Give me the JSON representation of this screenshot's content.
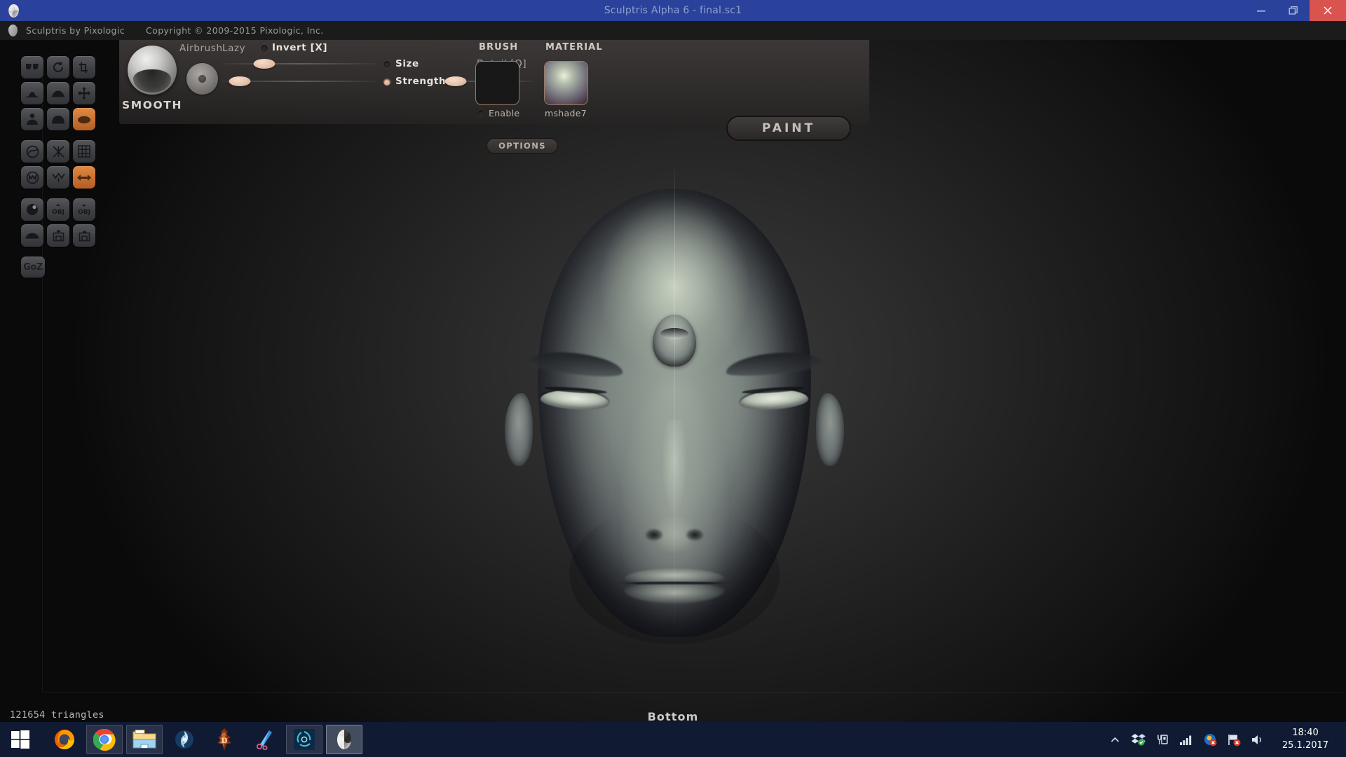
{
  "window": {
    "title": "Sculptris Alpha 6 - final.sc1",
    "app_icon": "sculptris-logo-icon",
    "minimize_label": "Minimize",
    "restore_label": "Restore",
    "close_label": "Close",
    "titlebar_color": "#2a429b",
    "close_color": "#d9534f"
  },
  "menustrip": {
    "app_name": "Sculptris by Pixologic",
    "copyright": "Copyright © 2009-2015 Pixologic, Inc."
  },
  "toolpalette": {
    "rows": [
      [
        {
          "name": "tool-crease",
          "icon": "crease-icon",
          "active": false
        },
        {
          "name": "tool-rotate",
          "icon": "rotate-icon",
          "active": false
        },
        {
          "name": "tool-crop",
          "icon": "crop-icon",
          "active": false
        }
      ],
      [
        {
          "name": "tool-draw",
          "icon": "draw-icon",
          "active": false
        },
        {
          "name": "tool-inflate",
          "icon": "inflate-icon",
          "active": false
        },
        {
          "name": "tool-grab",
          "icon": "move-arrows-icon",
          "active": false
        }
      ],
      [
        {
          "name": "tool-pinch",
          "icon": "pinch-icon",
          "active": false
        },
        {
          "name": "tool-flatten",
          "icon": "flatten-icon",
          "active": false
        },
        {
          "name": "tool-smooth",
          "icon": "smooth-icon",
          "active": true
        }
      ]
    ],
    "rows2": [
      [
        {
          "name": "tool-reduce-brush",
          "icon": "circle-swirl-icon",
          "active": false
        },
        {
          "name": "tool-mask",
          "icon": "x-cross-icon",
          "active": false
        },
        {
          "name": "tool-wireframe",
          "icon": "grid-icon",
          "active": false
        }
      ],
      [
        {
          "name": "tool-mask-toggle",
          "icon": "m-circle-icon",
          "active": false
        },
        {
          "name": "tool-reduce-selected",
          "icon": "w-arrow-icon",
          "active": false
        },
        {
          "name": "tool-symmetry",
          "icon": "double-arrow-icon",
          "active": true
        }
      ]
    ],
    "rows3": [
      [
        {
          "name": "tool-new-sphere",
          "icon": "sphere-icon",
          "active": false
        },
        {
          "name": "tool-import-obj",
          "icon": "obj-import-icon",
          "active": false
        },
        {
          "name": "tool-export-obj",
          "icon": "obj-export-icon",
          "active": false
        }
      ],
      [
        {
          "name": "tool-new-plane",
          "icon": "plane-icon",
          "active": false
        },
        {
          "name": "tool-open-file",
          "icon": "open-icon",
          "active": false
        },
        {
          "name": "tool-save-file",
          "icon": "save-icon",
          "active": false
        }
      ]
    ],
    "goz_label": "GoZ"
  },
  "brushbar": {
    "brush_name": "SMOOTH",
    "brush_preview_icon": "smooth-brush-preview-icon",
    "falloff_icon": "falloff-knob-icon",
    "airbrush_label": "Airbrush",
    "lazy_label": "Lazy",
    "invert_label": "Invert [X]",
    "size_label": "Size",
    "strength_label": "Strength",
    "detail_label": "Detail [Q]",
    "options_label": "OPTIONS",
    "size_value": 28,
    "strength_value": 12,
    "detail_value": 14,
    "invert_on": false,
    "size_on": false,
    "strength_on": true
  },
  "brushpanel": {
    "brush_title": "BRUSH",
    "brush_enable_label": "Enable",
    "brush_enabled": false,
    "material_title": "MATERIAL",
    "material_name": "mshade7",
    "paint_label": "PAINT",
    "swatch_border_color": "#9a7a64"
  },
  "viewport": {
    "triangle_count": "121654 triangles",
    "view_label": "Bottom",
    "model": "head-sculpt"
  },
  "taskbar": {
    "start_label": "Start",
    "apps": [
      {
        "name": "taskbar-firefox",
        "icon": "firefox-icon",
        "state": "pinned"
      },
      {
        "name": "taskbar-chrome",
        "icon": "chrome-icon",
        "state": "open"
      },
      {
        "name": "taskbar-file-explorer",
        "icon": "file-explorer-icon",
        "state": "open"
      },
      {
        "name": "taskbar-battlenet",
        "icon": "battlenet-icon",
        "state": "pinned"
      },
      {
        "name": "taskbar-diablo3",
        "icon": "diablo3-icon",
        "state": "pinned"
      },
      {
        "name": "taskbar-snipping-tool",
        "icon": "snip-tool-icon",
        "state": "pinned"
      },
      {
        "name": "taskbar-teal-swirl",
        "icon": "teal-swirl-icon",
        "state": "open"
      },
      {
        "name": "taskbar-sculptris",
        "icon": "sculptris-logo-icon",
        "state": "active"
      }
    ],
    "tray": [
      {
        "name": "tray-show-hidden",
        "icon": "chevron-up-icon"
      },
      {
        "name": "tray-dropbox",
        "icon": "dropbox-icon"
      },
      {
        "name": "tray-battery",
        "icon": "battery-charging-icon"
      },
      {
        "name": "tray-network",
        "icon": "signal-bars-icon"
      },
      {
        "name": "tray-sync-error",
        "icon": "sync-error-icon"
      },
      {
        "name": "tray-action-center",
        "icon": "flag-error-icon"
      },
      {
        "name": "tray-volume",
        "icon": "speaker-icon"
      }
    ],
    "clock_time": "18:40",
    "clock_date": "25.1.2017"
  }
}
